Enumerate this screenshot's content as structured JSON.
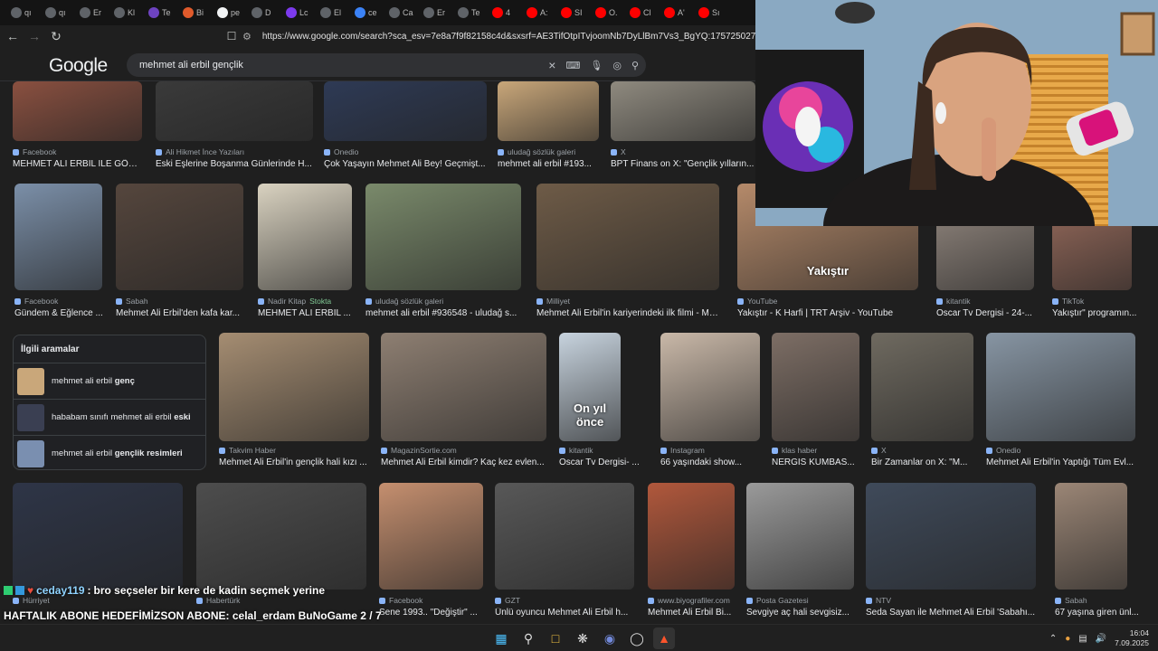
{
  "tabs": [
    {
      "label": "qı",
      "color": "#5f6368"
    },
    {
      "label": "qı",
      "color": "#5f6368"
    },
    {
      "label": "Er",
      "color": "#5f6368"
    },
    {
      "label": "Kl",
      "color": "#5f6368"
    },
    {
      "label": "Te",
      "color": "#6e43c1"
    },
    {
      "label": "Bi",
      "color": "#e05a2b"
    },
    {
      "label": "pe",
      "color": "#f1f3f4"
    },
    {
      "label": "D",
      "color": "#5f6368"
    },
    {
      "label": "Lc",
      "color": "#7c3aed"
    },
    {
      "label": "El",
      "color": "#5f6368"
    },
    {
      "label": "ce",
      "color": "#3b82f6"
    },
    {
      "label": "Ca",
      "color": "#5f6368"
    },
    {
      "label": "Er",
      "color": "#5f6368"
    },
    {
      "label": "Te",
      "color": "#5f6368"
    },
    {
      "label": "4",
      "color": "#ff0000"
    },
    {
      "label": "A:",
      "color": "#ff0000"
    },
    {
      "label": "SI",
      "color": "#ff0000"
    },
    {
      "label": "O.",
      "color": "#ff0000"
    },
    {
      "label": "Cl",
      "color": "#ff0000"
    },
    {
      "label": "A'",
      "color": "#ff0000"
    },
    {
      "label": "Sı",
      "color": "#ff0000"
    }
  ],
  "address": {
    "url": "https://www.google.com/search?sca_esv=7e8a7f9f82158c4d&sxsrf=AE3TifOtpITvjoomNb7DyLlBm7Vs3_BgYQ:1757250271522&udm"
  },
  "google": {
    "logo": "Google",
    "query": "mehmet ali erbil gençlik"
  },
  "row1": [
    {
      "source": "Facebook",
      "title": "MEHMET ALİ ERBİL İLE GÖL ...",
      "color": "#8a5040"
    },
    {
      "source": "Ali Hikmet İnce Yazıları",
      "title": "Eski Eşlerine Boşanma Günlerinde H...",
      "color": "#3a3a3a"
    },
    {
      "source": "Onedio",
      "title": "Çok Yaşayın Mehmet Ali Bey! Geçmişt...",
      "color": "#2e3a55"
    },
    {
      "source": "uludağ sözlük galeri",
      "title": "mehmet ali erbil #193...",
      "color": "#c9a77a"
    },
    {
      "source": "X",
      "title": "BPT Finans on X: \"Gençlik yılların...",
      "color": "#8f8a7f"
    }
  ],
  "row2": [
    {
      "source": "Facebook",
      "title": "Gündem & Eğlence ...",
      "color": "#7b8fa8"
    },
    {
      "source": "Sabah",
      "title": "Mehmet Ali Erbil'den kafa kar...",
      "color": "#55463d"
    },
    {
      "source": "Nadir Kitap",
      "source_extra": "Stokta",
      "title": "MEHMET ALİ ERBİL ...",
      "color": "#d9d2c0"
    },
    {
      "source": "uludağ sözlük galeri",
      "title": "mehmet ali erbil #936548 - uludağ s...",
      "color": "#7a8a6b"
    },
    {
      "source": "Milliyet",
      "title": "Mehmet Ali Erbil'in kariyerindeki ilk filmi - Ma...",
      "color": "#6e5b47"
    },
    {
      "source": "YouTube",
      "title": "Yakıştır - K Harfi | TRT Arşiv - YouTube",
      "color": "#b58a6a",
      "overlay": "Yakıştır"
    },
    {
      "source": "kitantik",
      "title": "Oscar Tv Dergisi - 24-...",
      "color": "#9b8f86"
    },
    {
      "source": "TikTok",
      "title": "Yakıştır\" programın...",
      "color": "#a07060"
    }
  ],
  "related": {
    "heading": "İlgili aramalar",
    "items": [
      {
        "prefix": "mehmet ali erbil ",
        "bold": "genç"
      },
      {
        "prefix": "hababam sınıfı mehmet ali erbil ",
        "bold": "eski"
      },
      {
        "prefix": "mehmet ali erbil ",
        "bold": "gençlik resimleri"
      }
    ]
  },
  "row3": [
    {
      "source": "Takvim Haber",
      "title": "Mehmet Ali Erbil'in gençlik hali kızı ...",
      "color": "#a58d72"
    },
    {
      "source": "MagazinSortie.com",
      "title": "Mehmet Ali Erbil kimdir? Kaç kez evlen...",
      "color": "#8e7f72"
    },
    {
      "source": "kitantik",
      "title": "Oscar Tv Dergisi- ...",
      "color": "#c7d3de",
      "overlay": "On yıl önce"
    },
    {
      "source": "Instagram",
      "title": "66 yaşındaki show...",
      "color": "#c9b8a8"
    },
    {
      "source": "klas haber",
      "title": "NERGİS KUMBAS...",
      "color": "#7d6e65"
    },
    {
      "source": "X",
      "title": "Bir Zamanlar on X: \"M...",
      "color": "#6f6a60"
    },
    {
      "source": "Onedio",
      "title": "Mehmet Ali Erbil'in Yaptığı Tüm Evl...",
      "color": "#8795a3"
    }
  ],
  "row4": [
    {
      "source": "Hürriyet",
      "title": "",
      "color": "#2e3547"
    },
    {
      "source": "Habertürk",
      "title": "",
      "color": "#4d4d4d"
    },
    {
      "source": "Facebook",
      "title": "Sene 1993.. \"Değiştir\" ...",
      "color": "#c58f6f"
    },
    {
      "source": "GZT",
      "title": "Ünlü oyuncu Mehmet Ali Erbil h...",
      "color": "#585858"
    },
    {
      "source": "www.biyografiler.com",
      "title": "Mehmet Ali Erbil Bi...",
      "color": "#b1583c"
    },
    {
      "source": "Posta Gazetesi",
      "title": "Sevgiye aç hali sevgisiz...",
      "color": "#9a9a9a"
    },
    {
      "source": "NTV",
      "title": "Seda Sayan ile Mehmet Ali Erbil 'Sabahı...",
      "color": "#3f4a5a"
    },
    {
      "source": "Sabah",
      "title": "67 yaşına giren ünl...",
      "color": "#9b8676"
    }
  ],
  "overlay": {
    "chat_user": "ceday119",
    "chat_message": "bro seçseler bir kere de kadin seçmek yerine",
    "ticker": "HAFTALIK ABONE HEDEFİMİZSON ABONE: celal_erdam  BuNoGame  2 / 7",
    "brand": "BuNoGame",
    "progress": 0.28
  },
  "taskbar": {
    "time": "16:04",
    "date": "7.09.2025"
  }
}
